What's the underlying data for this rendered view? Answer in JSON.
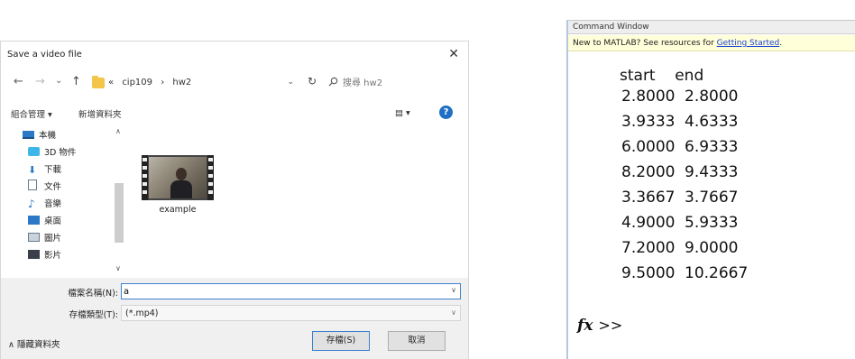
{
  "dialog": {
    "title": "Save a video file",
    "close_glyph": "✕",
    "nav": {
      "back": "←",
      "forward": "→",
      "recent": "⌄",
      "up": "↑",
      "breadcrumb": [
        "«",
        "cip109",
        "›",
        "hw2"
      ],
      "address_dropdown": "⌄",
      "refresh": "↻",
      "search_placeholder": "搜尋 hw2"
    },
    "toolbar": {
      "organize": "組合管理 ▾",
      "new_folder": "新增資料夾",
      "view": "▤ ▾",
      "help": "?"
    },
    "nav_items": [
      {
        "label": "本機",
        "icon": "computer-icon",
        "color": "#2b78c6"
      },
      {
        "label": "3D 物件",
        "icon": "3d-objects-icon",
        "color": "#3fb6e8"
      },
      {
        "label": "下載",
        "icon": "download-icon",
        "color": "#2b78c6"
      },
      {
        "label": "文件",
        "icon": "document-icon",
        "color": "#6b7a8c"
      },
      {
        "label": "音樂",
        "icon": "music-icon",
        "color": "#2b78c6"
      },
      {
        "label": "桌面",
        "icon": "desktop-icon",
        "color": "#2b78c6"
      },
      {
        "label": "圖片",
        "icon": "pictures-icon",
        "color": "#6b7a8c"
      },
      {
        "label": "影片",
        "icon": "videos-icon",
        "color": "#3a3f4a"
      }
    ],
    "files": [
      {
        "name": "example",
        "icon": "video-file-icon"
      }
    ],
    "filename_label": "檔案名稱(N):",
    "filename_value": "a",
    "filetype_label": "存檔類型(T):",
    "filetype_value": "(*.mp4)",
    "hide_folders": "∧ 隱藏資料夾",
    "save_button": "存檔(S)",
    "cancel_button": "取消"
  },
  "command_window": {
    "title": "Command Window",
    "notice_text": "New to MATLAB? See resources for ",
    "notice_link": "Getting Started",
    "notice_end": ".",
    "column_header": "start    end",
    "rows": [
      [
        "2.8000",
        "2.8000"
      ],
      [
        "3.9333",
        "4.6333"
      ],
      [
        "6.0000",
        "6.9333"
      ],
      [
        "8.2000",
        "9.4333"
      ],
      [
        "3.3667",
        "3.7667"
      ],
      [
        "4.9000",
        "5.9333"
      ],
      [
        "7.2000",
        "9.0000"
      ],
      [
        "9.5000",
        "10.2667"
      ]
    ],
    "fx_label": "fx",
    "prompt": ">>"
  }
}
